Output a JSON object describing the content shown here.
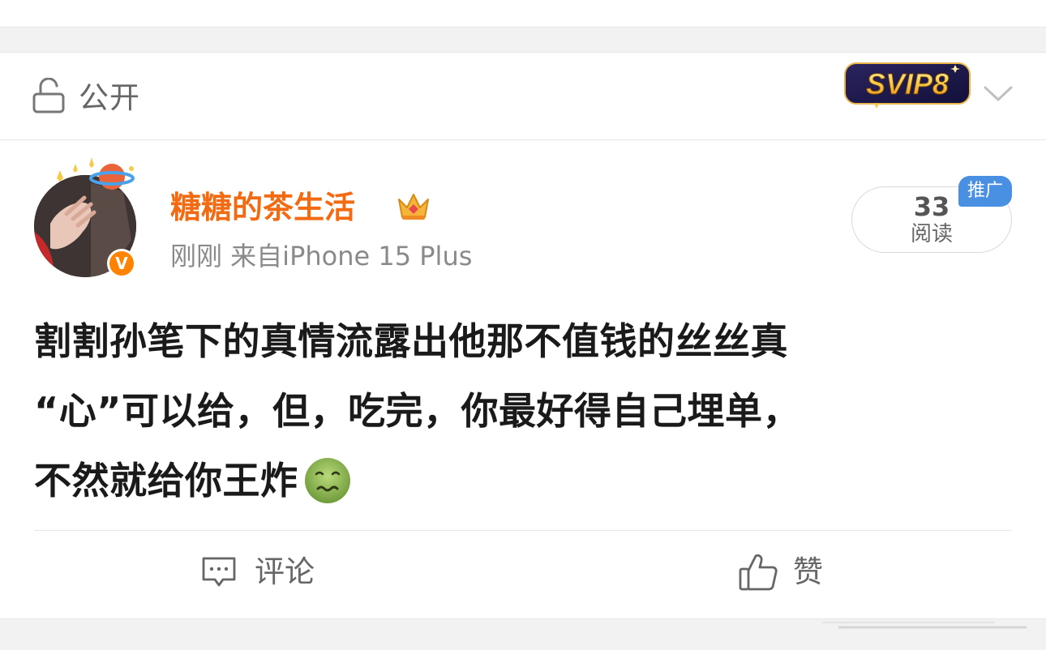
{
  "visibility": {
    "icon": "lock-open-icon",
    "label": "公开",
    "svip_badge": "SVIP8",
    "dropdown_icon": "chevron-down-icon"
  },
  "post": {
    "author": {
      "name": "糖糖的茶生活",
      "verified_mark": "V",
      "crown_icon": "crown-icon"
    },
    "meta": "刚刚  来自iPhone 15 Plus",
    "read_count": "33",
    "read_label": "阅读",
    "promo_label": "推广",
    "text_line1": "割割孙笔下的真情流露出他那不值钱的丝丝真",
    "text_line2": "“心”可以给，但，吃完，你最好得自己埋单，",
    "text_line3": "不然就给你王炸",
    "emoji": "nauseated-face-emoji"
  },
  "actions": {
    "comment_label": "评论",
    "like_label": "赞"
  },
  "colors": {
    "username": "#f26b12",
    "verified": "#ff8200",
    "promo": "#4a90e2",
    "muted_text": "#8a8a8a"
  }
}
